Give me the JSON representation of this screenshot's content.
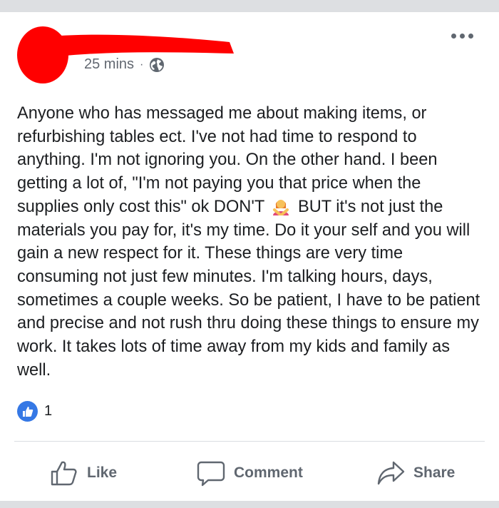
{
  "post": {
    "time": "25 mins",
    "separator": "·",
    "privacy_icon": "globe-icon",
    "text_before_emoji": "Anyone who has messaged me about making items, or refurbishing tables ect. I've not had time to respond to anything. I'm not ignoring you. On the other hand. I been getting a lot of, \"I'm not paying you that price when the supplies only cost this\" ok DON'T",
    "emoji": "woman-gesturing-no-emoji",
    "text_after_emoji": "BUT it's not just the materials you pay for, it's my time. Do it your self and you will gain a new respect for it. These things are very time consuming not just few minutes. I'm talking hours, days, sometimes a couple weeks. So be patient, I have to be patient and precise and not rush thru doing these things to ensure my work. It takes lots of time away from my kids and family as well.",
    "reaction_count": "1"
  },
  "actions": {
    "like": "Like",
    "comment": "Comment",
    "share": "Share"
  },
  "colors": {
    "like_blue": "#3578e5",
    "redaction_red": "#ff0000",
    "text": "#1c1e21",
    "secondary_text": "#606770"
  }
}
